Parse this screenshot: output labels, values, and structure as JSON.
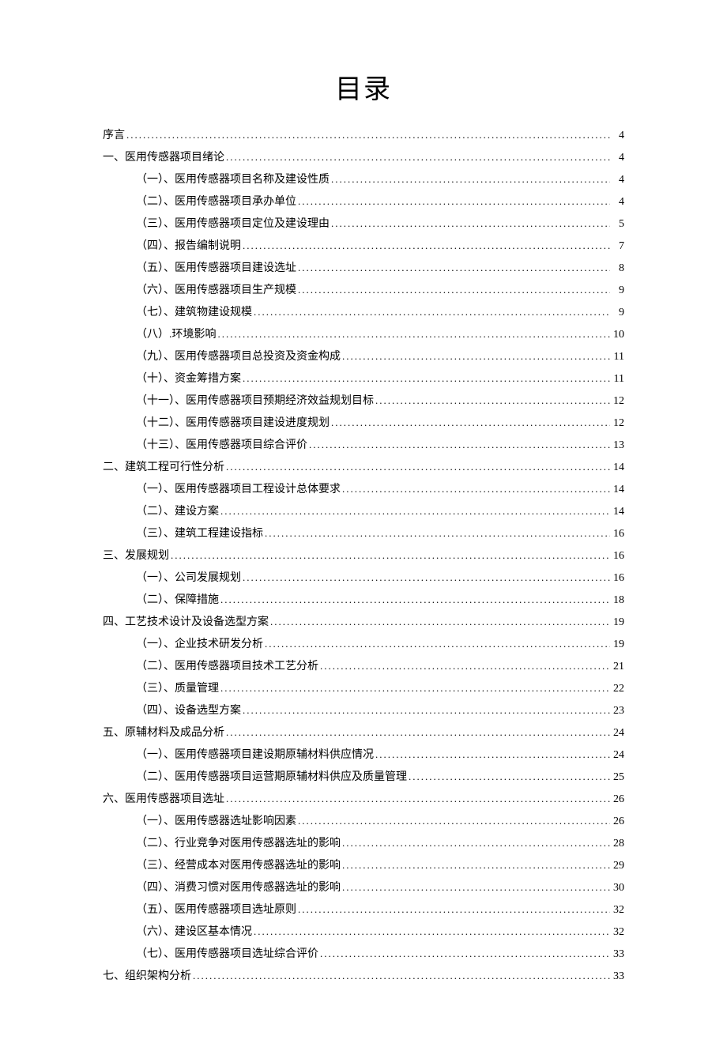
{
  "title": "目录",
  "toc": [
    {
      "level": 0,
      "label": "序言",
      "page": "4"
    },
    {
      "level": 0,
      "label": "一、医用传感器项目绪论",
      "page": "4"
    },
    {
      "level": 1,
      "label": "（一）、医用传感器项目名称及建设性质",
      "page": "4"
    },
    {
      "level": 1,
      "label": "（二）、医用传感器项目承办单位",
      "page": "4"
    },
    {
      "level": 1,
      "label": "（三）、医用传感器项目定位及建设理由",
      "page": "5"
    },
    {
      "level": 1,
      "label": "（四）、报告编制说明",
      "page": "7"
    },
    {
      "level": 1,
      "label": "（五）、医用传感器项目建设选址",
      "page": "8"
    },
    {
      "level": 1,
      "label": "（六）、医用传感器项目生产规模",
      "page": "9"
    },
    {
      "level": 1,
      "label": "（七）、建筑物建设规模",
      "page": "9"
    },
    {
      "level": 1,
      "label": "（八）.环境影响",
      "page": "10"
    },
    {
      "level": 1,
      "label": "（九）、医用传感器项目总投资及资金构成",
      "page": "11"
    },
    {
      "level": 1,
      "label": "（十）、资金筹措方案",
      "page": "11"
    },
    {
      "level": 1,
      "label": "（十一）、医用传感器项目预期经济效益规划目标",
      "page": "12"
    },
    {
      "level": 1,
      "label": "（十二）、医用传感器项目建设进度规划",
      "page": "12"
    },
    {
      "level": 1,
      "label": "（十三）、医用传感器项目综合评价",
      "page": "13"
    },
    {
      "level": 0,
      "label": "二、建筑工程可行性分析",
      "page": "14"
    },
    {
      "level": 1,
      "label": "（一）、医用传感器项目工程设计总体要求",
      "page": "14"
    },
    {
      "level": 1,
      "label": "（二）、建设方案",
      "page": "14"
    },
    {
      "level": 1,
      "label": "（三）、建筑工程建设指标",
      "page": "16"
    },
    {
      "level": 0,
      "label": "三、发展规划",
      "page": "16"
    },
    {
      "level": 1,
      "label": "（一）、公司发展规划",
      "page": "16"
    },
    {
      "level": 1,
      "label": "（二）、保障措施",
      "page": "18"
    },
    {
      "level": 0,
      "label": "四、工艺技术设计及设备选型方案",
      "page": "19"
    },
    {
      "level": 1,
      "label": "（一）、企业技术研发分析",
      "page": "19"
    },
    {
      "level": 1,
      "label": "（二）、医用传感器项目技术工艺分析",
      "page": "21"
    },
    {
      "level": 1,
      "label": "（三）、质量管理",
      "page": "22"
    },
    {
      "level": 1,
      "label": "（四）、设备选型方案",
      "page": "23"
    },
    {
      "level": 0,
      "label": "五、原辅材料及成品分析",
      "page": "24"
    },
    {
      "level": 1,
      "label": "（一）、医用传感器项目建设期原辅材料供应情况",
      "page": "24"
    },
    {
      "level": 1,
      "label": "（二）、医用传感器项目运营期原辅材料供应及质量管理",
      "page": "25"
    },
    {
      "level": 0,
      "label": "六、医用传感器项目选址",
      "page": "26"
    },
    {
      "level": 1,
      "label": "（一）、医用传感器选址影响因素",
      "page": "26"
    },
    {
      "level": 1,
      "label": "（二）、行业竞争对医用传感器选址的影响",
      "page": "28"
    },
    {
      "level": 1,
      "label": "（三）、经营成本对医用传感器选址的影响",
      "page": "29"
    },
    {
      "level": 1,
      "label": "（四）、消费习惯对医用传感器选址的影响",
      "page": "30"
    },
    {
      "level": 1,
      "label": "（五）、医用传感器项目选址原则",
      "page": "32"
    },
    {
      "level": 1,
      "label": "（六）、建设区基本情况",
      "page": "32"
    },
    {
      "level": 1,
      "label": "（七）、医用传感器项目选址综合评价",
      "page": "33"
    },
    {
      "level": 0,
      "label": "七、组织架构分析",
      "page": "33"
    }
  ]
}
